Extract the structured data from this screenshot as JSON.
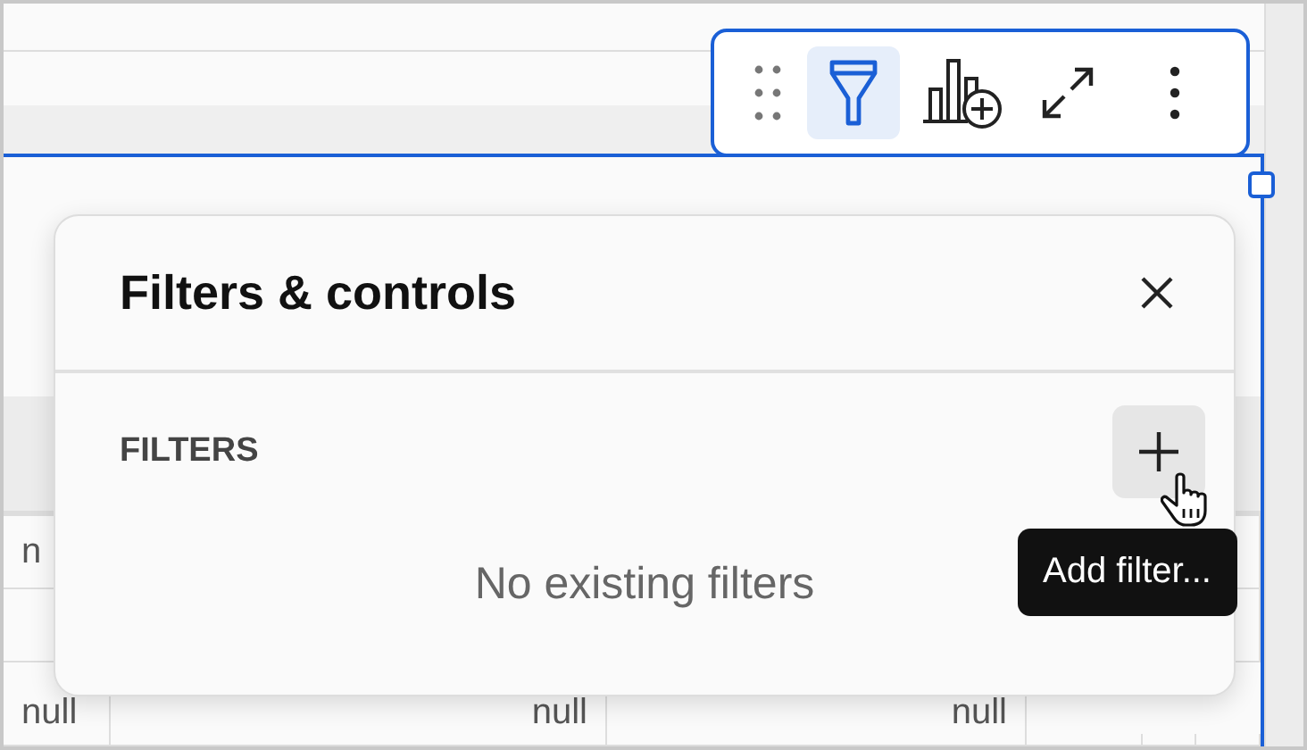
{
  "toolbar": {
    "buttons": [
      {
        "kind": "drag",
        "selected": false
      },
      {
        "kind": "filter",
        "selected": true
      },
      {
        "kind": "add-chart",
        "selected": false
      },
      {
        "kind": "expand",
        "selected": false
      },
      {
        "kind": "more",
        "selected": false
      }
    ]
  },
  "table": {
    "rows": [
      {
        "cells": [
          "n",
          "",
          "",
          "",
          "",
          ""
        ]
      },
      {
        "cells": [
          "",
          "",
          "",
          "",
          "",
          ""
        ]
      },
      {
        "cells": [
          "null",
          "null",
          "null",
          "",
          "",
          ""
        ]
      }
    ]
  },
  "panel": {
    "title": "Filters & controls",
    "section": "FILTERS",
    "empty_message": "No existing filters"
  },
  "tooltip": {
    "text": "Add filter..."
  }
}
